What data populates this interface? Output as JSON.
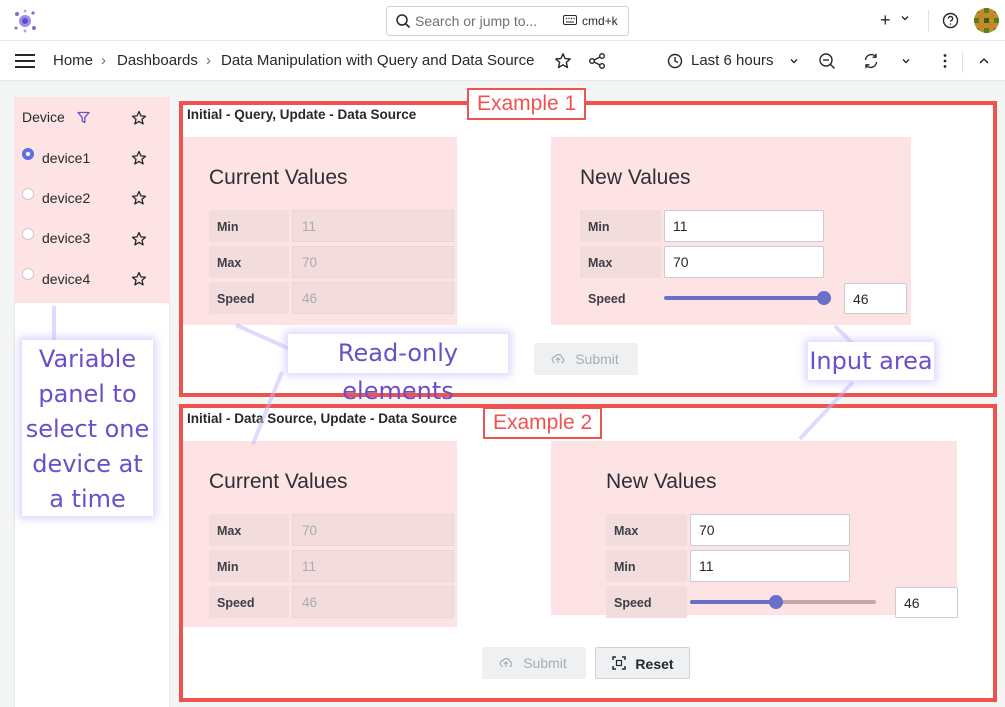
{
  "topbar": {
    "search_placeholder": "Search or jump to...",
    "shortcut": "cmd+k",
    "plus": "+"
  },
  "breadcrumb": {
    "home": "Home",
    "dashboards": "Dashboards",
    "current": "Data Manipulation with Query and Data Source",
    "sep": "›"
  },
  "timepicker": {
    "label": "Last 6 hours"
  },
  "variable": {
    "title": "Device",
    "options": [
      {
        "label": "device1",
        "selected": true
      },
      {
        "label": "device2",
        "selected": false
      },
      {
        "label": "device3",
        "selected": false
      },
      {
        "label": "device4",
        "selected": false
      }
    ]
  },
  "panel1": {
    "title": "Initial - Query, Update - Data Source",
    "tag": "Example 1",
    "current": {
      "title": "Current Values",
      "fields": [
        {
          "label": "Min",
          "value": "11"
        },
        {
          "label": "Max",
          "value": "70"
        },
        {
          "label": "Speed",
          "value": "46"
        }
      ]
    },
    "new": {
      "title": "New Values",
      "min_label": "Min",
      "min_value": "11",
      "max_label": "Max",
      "max_value": "70",
      "speed_label": "Speed",
      "speed_value": "46",
      "slider_fraction": 1.0
    },
    "submit": "Submit"
  },
  "panel2": {
    "title": "Initial - Data Source, Update - Data Source",
    "tag": "Example 2",
    "current": {
      "title": "Current Values",
      "fields": [
        {
          "label": "Max",
          "value": "70"
        },
        {
          "label": "Min",
          "value": "11"
        },
        {
          "label": "Speed",
          "value": "46"
        }
      ]
    },
    "new": {
      "title": "New Values",
      "max_label": "Max",
      "max_value": "70",
      "min_label": "Min",
      "min_value": "11",
      "speed_label": "Speed",
      "speed_value": "46",
      "slider_fraction": 0.46
    },
    "submit": "Submit",
    "reset": "Reset"
  },
  "annotations": {
    "variable_panel": "Variable panel to select one device at a time",
    "readonly": "Read-only elements",
    "input": "Input area"
  },
  "colors": {
    "accent": "#ef5350",
    "pink": "#fde3e3",
    "slider": "#6a6fc7",
    "annotation_text": "#6a4fc9"
  }
}
